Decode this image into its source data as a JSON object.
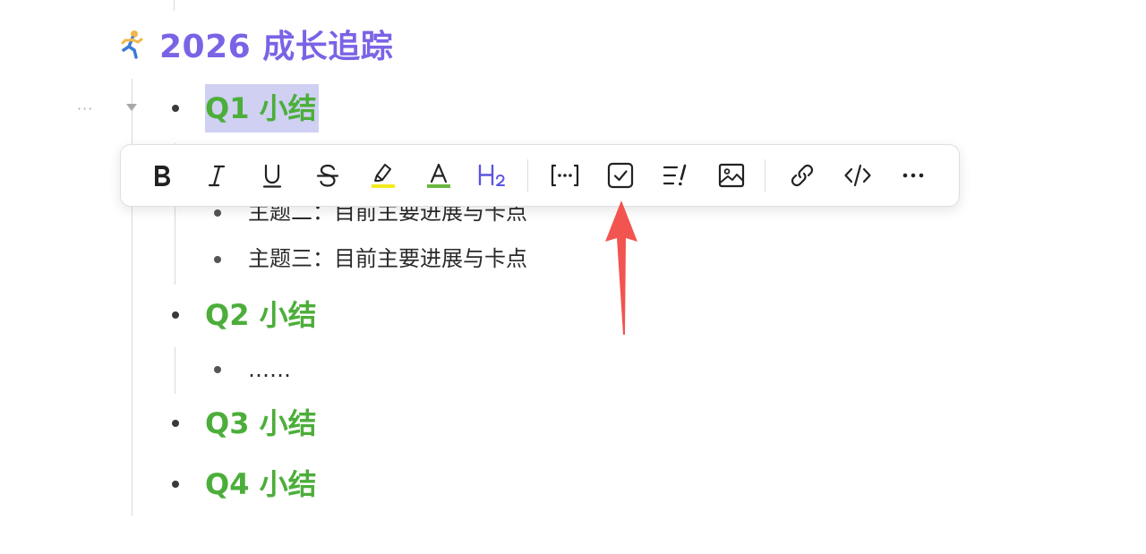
{
  "document": {
    "title": "2026 成长追踪",
    "title_emoji": "running-person-icon",
    "sections": [
      {
        "label": "Q1 小结",
        "selected": true
      },
      {
        "label": "Q2 小结",
        "selected": false
      },
      {
        "label": "Q3 小结",
        "selected": false
      },
      {
        "label": "Q4 小结",
        "selected": false
      }
    ],
    "q1_items": [
      "主题二：目前主要进展与卡点",
      "主题三：目前主要进展与卡点"
    ],
    "q2_items": [
      "……"
    ]
  },
  "block_controls": {
    "menu_glyph": "···"
  },
  "toolbar": {
    "buttons": [
      {
        "name": "bold",
        "icon": "bold-icon"
      },
      {
        "name": "italic",
        "icon": "italic-icon"
      },
      {
        "name": "underline",
        "icon": "underline-icon"
      },
      {
        "name": "strikethrough",
        "icon": "strikethrough-icon"
      },
      {
        "name": "highlight",
        "icon": "highlighter-icon"
      },
      {
        "name": "text-color",
        "icon": "text-color-icon"
      },
      {
        "name": "heading",
        "icon": "heading-icon",
        "label": "H",
        "sub": "2"
      },
      {
        "name": "block-reference",
        "icon": "bracket-ellipsis-icon"
      },
      {
        "name": "todo",
        "icon": "checkbox-icon"
      },
      {
        "name": "callout",
        "icon": "list-exclamation-icon"
      },
      {
        "name": "image",
        "icon": "image-icon"
      },
      {
        "name": "link",
        "icon": "link-icon"
      },
      {
        "name": "code",
        "icon": "code-icon"
      },
      {
        "name": "more",
        "icon": "more-horizontal-icon"
      }
    ]
  },
  "colors": {
    "title": "#7b63e6",
    "heading": "#4cae3a",
    "selection": "#cfd0f2",
    "highlight": "#f5ea1c",
    "text_color_bar": "#69b83e",
    "heading_icon": "#5b55e0",
    "annotation_arrow": "#f25450"
  }
}
